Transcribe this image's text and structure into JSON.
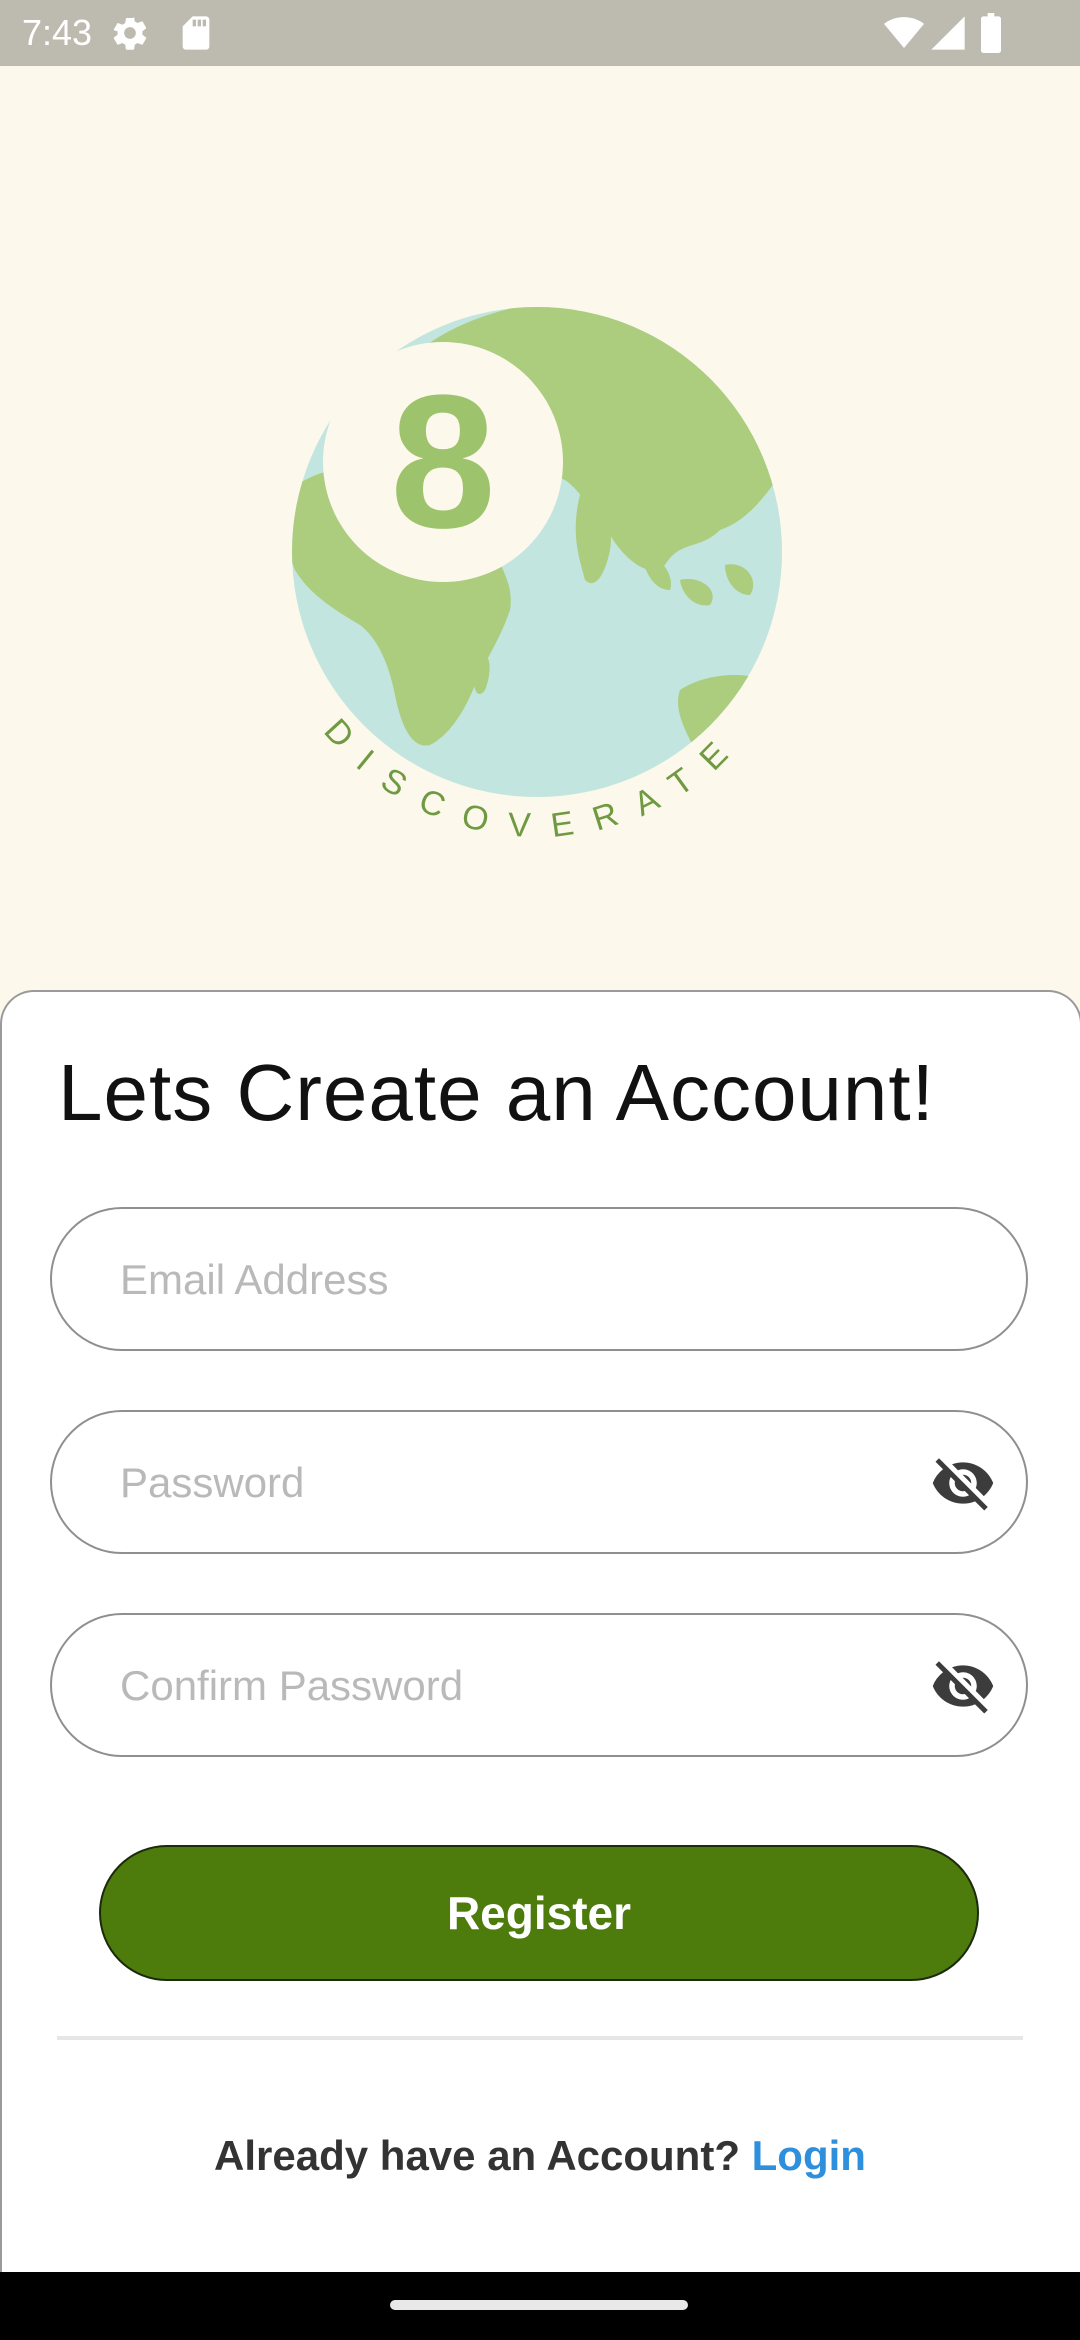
{
  "status_bar": {
    "time": "7:43",
    "icons": [
      "settings-icon",
      "sd-card-icon",
      "wifi-icon",
      "signal-icon",
      "battery-icon"
    ]
  },
  "logo": {
    "badge_number": "8",
    "wordmark": "DISCOVERATE",
    "colors": {
      "ocean": "#c2e5df",
      "land": "#abcd7d",
      "badge": "#fcf8eb",
      "number": "#9dc46c",
      "text": "#6f9a42"
    }
  },
  "register_form": {
    "title": "Lets Create an Account!",
    "email": {
      "placeholder": "Email Address",
      "value": ""
    },
    "password": {
      "placeholder": "Password",
      "value": "",
      "visibility_icon": "eye-off-icon"
    },
    "confirm_password": {
      "placeholder": "Confirm Password",
      "value": "",
      "visibility_icon": "eye-off-icon"
    },
    "register_label": "Register",
    "login_prompt": "Already have an Account?",
    "login_link": "Login"
  },
  "colors": {
    "background": "#fcf8eb",
    "primary_button": "#4d7b0c",
    "link": "#2e8fdc"
  }
}
